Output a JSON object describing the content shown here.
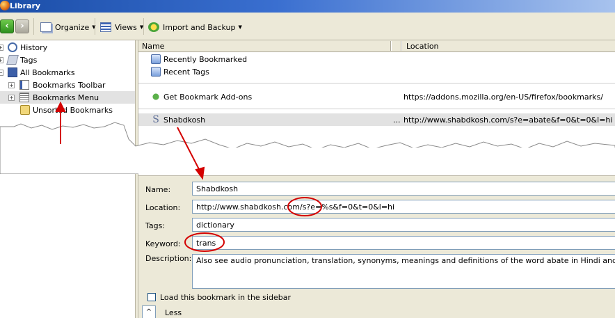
{
  "window": {
    "title": "Library"
  },
  "toolbar": {
    "organize_label": "Organize",
    "views_label": "Views",
    "import_label": "Import and Backup"
  },
  "tree": {
    "items": [
      {
        "label": "History"
      },
      {
        "label": "Tags"
      },
      {
        "label": "All Bookmarks"
      },
      {
        "label": "Bookmarks Toolbar"
      },
      {
        "label": "Bookmarks Menu"
      },
      {
        "label": "Unsorted Bookmarks"
      }
    ]
  },
  "list": {
    "columns": {
      "name": "Name",
      "location": "Location"
    },
    "rows": [
      {
        "name": "Recently Bookmarked",
        "location": ""
      },
      {
        "name": "Recent Tags",
        "location": ""
      },
      {
        "name": "Get Bookmark Add-ons",
        "location": "https://addons.mozilla.org/en-US/firefox/bookmarks/"
      },
      {
        "name": "Shabdkosh",
        "ellipsis": "...",
        "location": "http://www.shabdkosh.com/s?e=abate&f=0&t=0&l=hi"
      }
    ]
  },
  "details": {
    "name_label": "Name:",
    "name_value": "Shabdkosh",
    "location_label": "Location:",
    "location_value": "http://www.shabdkosh.com/s?e=%s&f=0&t=0&l=hi",
    "tags_label": "Tags:",
    "tags_value": "dictionary",
    "keyword_label": "Keyword:",
    "keyword_value": "trans",
    "description_label": "Description:",
    "description_value": "Also see audio pronunciation, translation, synonyms, meanings and definitions of the word abate in Hindi and English. Provide",
    "sidebar_checkbox_label": "Load this bookmark in the sidebar",
    "less_label": "Less",
    "less_arrow": "^"
  },
  "icons": {
    "back": "back-arrow-icon",
    "forward": "forward-arrow-icon",
    "organize": "organize-icon",
    "views": "views-icon",
    "import": "import-backup-icon",
    "history": "clock-icon",
    "tags": "tag-icon",
    "all_bookmarks": "star-bookmark-icon",
    "bookmarks_toolbar": "toolbar-icon",
    "bookmarks_menu": "menu-icon",
    "unsorted": "unsorted-bookmark-icon"
  },
  "colors": {
    "annotation": "#d40000",
    "selection": "#e2e2e2",
    "titlebar": "#1b4ea8"
  }
}
